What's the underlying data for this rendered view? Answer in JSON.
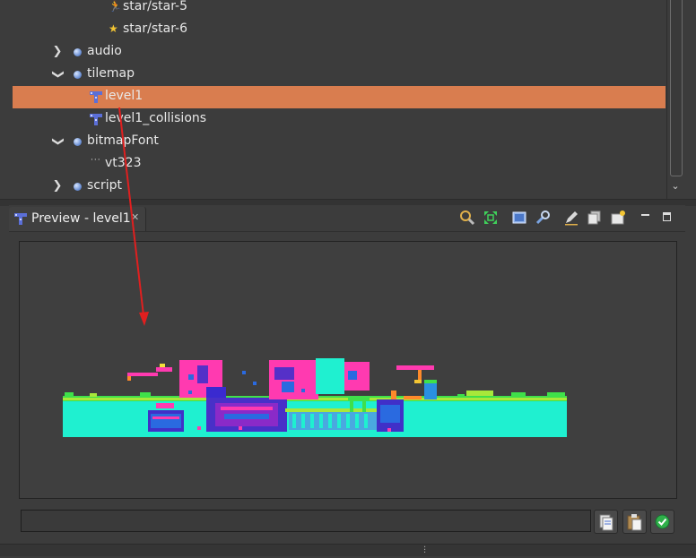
{
  "tree": {
    "items": [
      {
        "label": "star/star-5",
        "icon": "star-icon"
      },
      {
        "label": "star/star-6",
        "icon": "star-icon"
      },
      {
        "label": "audio",
        "icon": "folder-dot-icon",
        "expander": "collapsed"
      },
      {
        "label": "tilemap",
        "icon": "folder-dot-icon",
        "expander": "expanded"
      },
      {
        "label": "level1",
        "icon": "tilemap-icon",
        "selected": true
      },
      {
        "label": "level1_collisions",
        "icon": "tilemap-icon"
      },
      {
        "label": "bitmapFont",
        "icon": "folder-dot-icon",
        "expander": "expanded"
      },
      {
        "label": "vt323",
        "icon": "bitmap-font-icon"
      },
      {
        "label": "script",
        "icon": "folder-dot-icon",
        "expander": "collapsed"
      }
    ]
  },
  "preview": {
    "tab_title": "Preview - level1",
    "toolbar": [
      "zoom-icon",
      "fit-view-icon",
      "grid-toggle-icon",
      "settings-wrench-icon",
      "edit-icon",
      "layers-icon",
      "new-layer-icon"
    ],
    "view_controls": [
      "minimize-icon",
      "maximize-icon"
    ]
  },
  "bottom": {
    "input_value": "",
    "buttons": [
      "copy-icon",
      "paste-icon",
      "confirm-icon"
    ]
  },
  "colors": {
    "selection": "#d97d4f",
    "panel_bg": "#3c3c3c",
    "annotation_arrow": "#e01f1f"
  }
}
